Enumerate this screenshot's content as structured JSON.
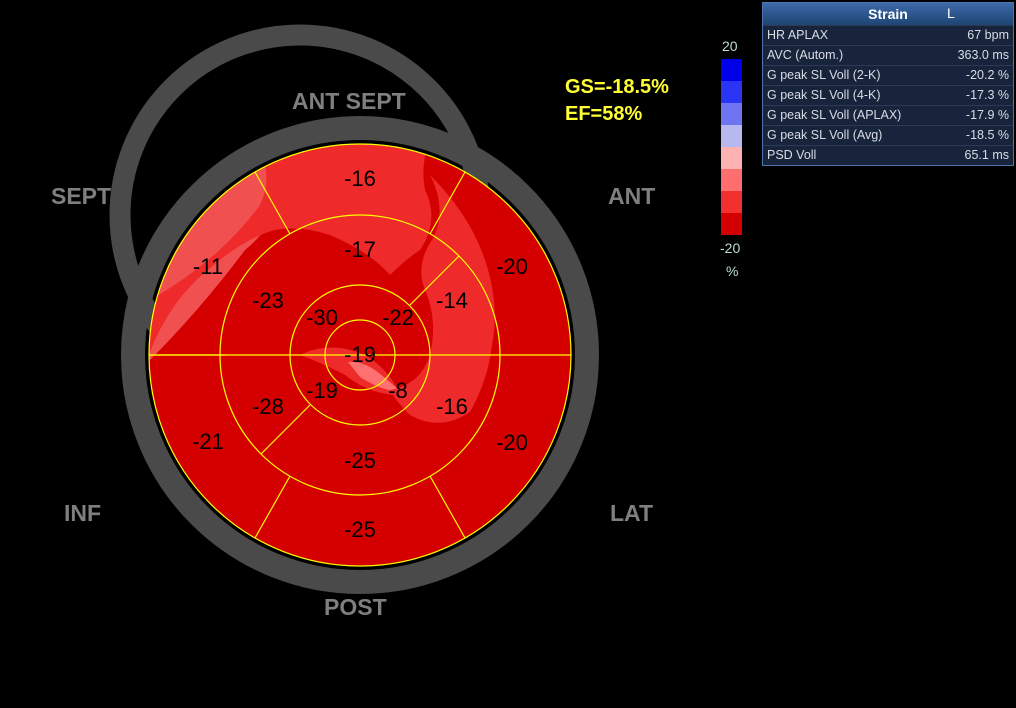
{
  "wall_labels": {
    "ant_sept": "ANT  SEPT",
    "sept": "SEPT",
    "ant": "ANT",
    "inf": "INF",
    "lat": "LAT",
    "post": "POST"
  },
  "summary": {
    "gs": "GS=-18.5%",
    "ef": "EF=58%"
  },
  "scale": {
    "max_label": "20",
    "min_label": "-20",
    "unit": "%",
    "colors": [
      "#0000e8",
      "#2a34f4",
      "#6e74f2",
      "#b8b8f0",
      "#ffb2b2",
      "#ff6e6e",
      "#f23030",
      "#d40000"
    ]
  },
  "panel": {
    "title": "Strain",
    "flag": "L",
    "rows": [
      {
        "label": "HR APLAX",
        "value": "67 bpm"
      },
      {
        "label": "AVC (Autom.)",
        "value": "363.0 ms"
      },
      {
        "label": "G peak SL Voll (2-K)",
        "value": "-20.2 %"
      },
      {
        "label": "G peak SL Voll (4-K)",
        "value": "-17.3 %"
      },
      {
        "label": "G peak SL Voll (APLAX)",
        "value": "-17.9 %"
      },
      {
        "label": "G peak SL Voll (Avg)",
        "value": "-18.5 %"
      },
      {
        "label": "PSD Voll",
        "value": "65.1 ms"
      }
    ]
  },
  "segments": {
    "basal": [
      "-16",
      "-20",
      "-20",
      "-25",
      "-21",
      "-11"
    ],
    "mid": [
      "-17",
      "-14",
      "-16",
      "-25",
      "-28",
      "-23"
    ],
    "apical": [
      "-22",
      "-8",
      "-19",
      "-30"
    ],
    "apex": "-19"
  },
  "colors": {
    "grid": "#ffff00",
    "ring": "#4a4a4a",
    "base_fill": "#d40000",
    "highlight_fill": "#ee2a2a"
  }
}
